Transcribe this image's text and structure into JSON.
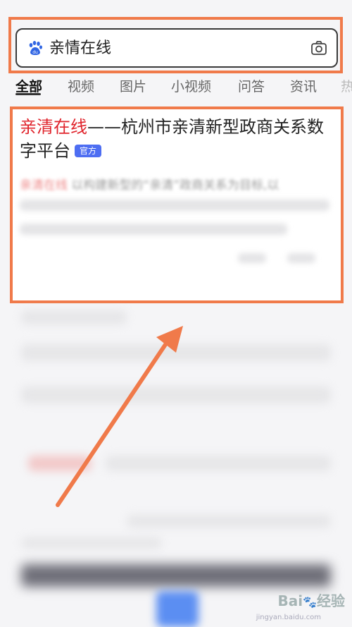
{
  "search": {
    "query": "亲情在线"
  },
  "tabs": [
    {
      "label": "全部",
      "active": true
    },
    {
      "label": "视频",
      "active": false
    },
    {
      "label": "图片",
      "active": false
    },
    {
      "label": "小视频",
      "active": false
    },
    {
      "label": "问答",
      "active": false
    },
    {
      "label": "资讯",
      "active": false
    },
    {
      "label": "热",
      "active": false
    }
  ],
  "result": {
    "title_highlight": "亲清在线",
    "title_rest": "——杭州市亲清新型政商关系数字平台",
    "badge": "官方",
    "snippet_highlight": "亲清在线",
    "snippet_rest": " 以构建新型的“亲清”政商关系为目标,以"
  },
  "watermark": {
    "brand": "Bai",
    "brand_suffix": "经验",
    "url": "jingyan.baidu.com"
  },
  "colors": {
    "highlight_red": "#e0242c",
    "annotation_orange": "#f07a4a",
    "badge_blue": "#4e6ef2"
  }
}
